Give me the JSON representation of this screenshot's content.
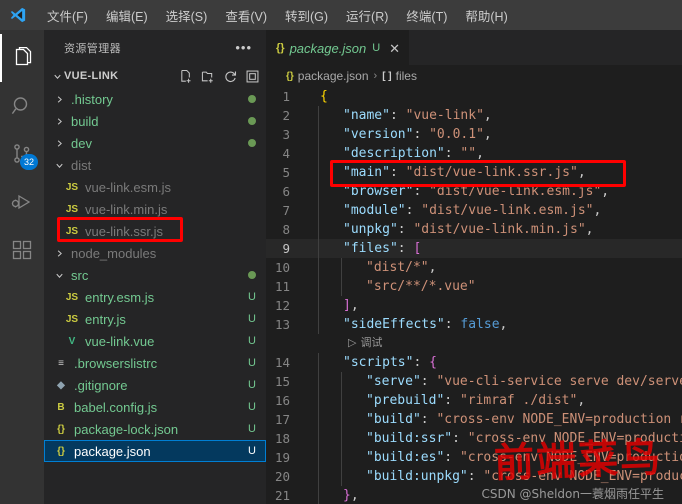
{
  "window": {
    "logo_icon": "vscode-logo-icon"
  },
  "menubar": {
    "items": [
      {
        "label": "文件(F)",
        "name": "menu-file"
      },
      {
        "label": "编辑(E)",
        "name": "menu-edit"
      },
      {
        "label": "选择(S)",
        "name": "menu-selection"
      },
      {
        "label": "查看(V)",
        "name": "menu-view"
      },
      {
        "label": "转到(G)",
        "name": "menu-go"
      },
      {
        "label": "运行(R)",
        "name": "menu-run"
      },
      {
        "label": "终端(T)",
        "name": "menu-terminal"
      },
      {
        "label": "帮助(H)",
        "name": "menu-help"
      }
    ]
  },
  "activitybar": {
    "items": [
      {
        "icon": "explorer-icon",
        "name": "activity-explorer",
        "active": true,
        "badge": ""
      },
      {
        "icon": "search-icon",
        "name": "activity-search",
        "active": false,
        "badge": ""
      },
      {
        "icon": "source-control-icon",
        "name": "activity-source-control",
        "active": false,
        "badge": "32"
      },
      {
        "icon": "run-debug-icon",
        "name": "activity-run-debug",
        "active": false,
        "badge": ""
      },
      {
        "icon": "extensions-icon",
        "name": "activity-extensions",
        "active": false,
        "badge": ""
      }
    ]
  },
  "sidebar": {
    "title": "资源管理器",
    "more_label": "•••",
    "root": {
      "label": "VUE-LINK",
      "expanded": true,
      "actions": [
        {
          "icon": "new-file-icon",
          "name": "new-file-button"
        },
        {
          "icon": "new-folder-icon",
          "name": "new-folder-button"
        },
        {
          "icon": "refresh-icon",
          "name": "refresh-explorer-button"
        },
        {
          "icon": "collapse-all-icon",
          "name": "collapse-all-button"
        }
      ]
    },
    "tree": [
      {
        "label": ".history",
        "kind": "folder",
        "expanded": false,
        "depth": 1,
        "icon": "chevron-right-icon",
        "color": "#73c991",
        "dot": "#6a9955",
        "status": ""
      },
      {
        "label": "build",
        "kind": "folder",
        "expanded": false,
        "depth": 1,
        "icon": "chevron-right-icon",
        "color": "#73c991",
        "dot": "#6a9955",
        "status": ""
      },
      {
        "label": "dev",
        "kind": "folder",
        "expanded": false,
        "depth": 1,
        "icon": "chevron-right-icon",
        "color": "#73c991",
        "dot": "#6a9955",
        "status": ""
      },
      {
        "label": "dist",
        "kind": "folder",
        "expanded": true,
        "depth": 1,
        "icon": "chevron-down-icon",
        "color": "#7a7a7a",
        "dot": "",
        "status": ""
      },
      {
        "label": "vue-link.esm.js",
        "kind": "file",
        "depth": 2,
        "icon": "js-file-icon",
        "iconText": "JS",
        "iconColor": "#cbcb41",
        "color": "#7a7a7a",
        "status": ""
      },
      {
        "label": "vue-link.min.js",
        "kind": "file",
        "depth": 2,
        "icon": "js-file-icon",
        "iconText": "JS",
        "iconColor": "#cbcb41",
        "color": "#7a7a7a",
        "status": ""
      },
      {
        "label": "vue-link.ssr.js",
        "kind": "file",
        "depth": 2,
        "icon": "js-file-icon",
        "iconText": "JS",
        "iconColor": "#cbcb41",
        "color": "#7a7a7a",
        "status": "",
        "highlighted": true
      },
      {
        "label": "node_modules",
        "kind": "folder",
        "expanded": false,
        "depth": 1,
        "icon": "chevron-right-icon",
        "color": "#7a7a7a",
        "dot": "",
        "status": ""
      },
      {
        "label": "src",
        "kind": "folder",
        "expanded": true,
        "depth": 1,
        "icon": "chevron-down-icon",
        "color": "#73c991",
        "dot": "#6a9955",
        "status": ""
      },
      {
        "label": "entry.esm.js",
        "kind": "file",
        "depth": 2,
        "icon": "js-file-icon",
        "iconText": "JS",
        "iconColor": "#cbcb41",
        "color": "#73c991",
        "status": "U"
      },
      {
        "label": "entry.js",
        "kind": "file",
        "depth": 2,
        "icon": "js-file-icon",
        "iconText": "JS",
        "iconColor": "#cbcb41",
        "color": "#73c991",
        "status": "U"
      },
      {
        "label": "vue-link.vue",
        "kind": "file",
        "depth": 2,
        "icon": "vue-file-icon",
        "iconText": "V",
        "iconColor": "#41b883",
        "color": "#73c991",
        "status": "U"
      },
      {
        "label": ".browserslistrc",
        "kind": "file",
        "depth": 1,
        "icon": "config-file-icon",
        "iconText": "≡",
        "iconColor": "#cccccc",
        "color": "#73c991",
        "status": "U"
      },
      {
        "label": ".gitignore",
        "kind": "file",
        "depth": 1,
        "icon": "git-file-icon",
        "iconText": "◆",
        "iconColor": "#8fa3b0",
        "color": "#73c991",
        "status": "U"
      },
      {
        "label": "babel.config.js",
        "kind": "file",
        "depth": 1,
        "icon": "babel-file-icon",
        "iconText": "B",
        "iconColor": "#cbcb41",
        "color": "#73c991",
        "status": "U"
      },
      {
        "label": "package-lock.json",
        "kind": "file",
        "depth": 1,
        "icon": "json-file-icon",
        "iconText": "{}",
        "iconColor": "#cbcb41",
        "color": "#73c991",
        "status": "U"
      },
      {
        "label": "package.json",
        "kind": "file",
        "depth": 1,
        "icon": "json-file-icon",
        "iconText": "{}",
        "iconColor": "#cbcb41",
        "color": "#ffffff",
        "status": "U",
        "selected": true
      }
    ]
  },
  "editor": {
    "tab": {
      "icon": "json-file-icon",
      "icon_text": "{}",
      "label": "package.json",
      "status": "U",
      "close_label": "✕"
    },
    "breadcrumb": {
      "icon_text": "{}",
      "file": "package.json",
      "separator": "›",
      "array_icon": "[ ]",
      "node": "files"
    },
    "codelens": {
      "icon": "play-icon",
      "label": "调试",
      "after_line": 13
    },
    "active_line": 9,
    "lines": [
      {
        "n": 1,
        "indent": 0,
        "tokens": [
          {
            "t": "{",
            "c": "br"
          }
        ]
      },
      {
        "n": 2,
        "indent": 1,
        "tokens": [
          {
            "t": "\"name\"",
            "c": "k"
          },
          {
            "t": ": ",
            "c": "p"
          },
          {
            "t": "\"vue-link\"",
            "c": "s"
          },
          {
            "t": ",",
            "c": "p"
          }
        ]
      },
      {
        "n": 3,
        "indent": 1,
        "tokens": [
          {
            "t": "\"version\"",
            "c": "k"
          },
          {
            "t": ": ",
            "c": "p"
          },
          {
            "t": "\"0.0.1\"",
            "c": "s"
          },
          {
            "t": ",",
            "c": "p"
          }
        ]
      },
      {
        "n": 4,
        "indent": 1,
        "tokens": [
          {
            "t": "\"description\"",
            "c": "k"
          },
          {
            "t": ": ",
            "c": "p"
          },
          {
            "t": "\"\"",
            "c": "s"
          },
          {
            "t": ",",
            "c": "p"
          }
        ]
      },
      {
        "n": 5,
        "indent": 1,
        "tokens": [
          {
            "t": "\"main\"",
            "c": "k"
          },
          {
            "t": ": ",
            "c": "p"
          },
          {
            "t": "\"dist/vue-link.ssr.js\"",
            "c": "s"
          },
          {
            "t": ",",
            "c": "p"
          }
        ]
      },
      {
        "n": 6,
        "indent": 1,
        "tokens": [
          {
            "t": "\"browser\"",
            "c": "k"
          },
          {
            "t": ": ",
            "c": "p"
          },
          {
            "t": "\"dist/vue-link.esm.js\"",
            "c": "s"
          },
          {
            "t": ",",
            "c": "p"
          }
        ]
      },
      {
        "n": 7,
        "indent": 1,
        "tokens": [
          {
            "t": "\"module\"",
            "c": "k"
          },
          {
            "t": ": ",
            "c": "p"
          },
          {
            "t": "\"dist/vue-link.esm.js\"",
            "c": "s"
          },
          {
            "t": ",",
            "c": "p"
          }
        ]
      },
      {
        "n": 8,
        "indent": 1,
        "tokens": [
          {
            "t": "\"unpkg\"",
            "c": "k"
          },
          {
            "t": ": ",
            "c": "p"
          },
          {
            "t": "\"dist/vue-link.min.js\"",
            "c": "s"
          },
          {
            "t": ",",
            "c": "p"
          }
        ]
      },
      {
        "n": 9,
        "indent": 1,
        "tokens": [
          {
            "t": "\"files\"",
            "c": "k"
          },
          {
            "t": ": ",
            "c": "p"
          },
          {
            "t": "[",
            "c": "br2"
          }
        ]
      },
      {
        "n": 10,
        "indent": 2,
        "tokens": [
          {
            "t": "\"dist/*\"",
            "c": "s"
          },
          {
            "t": ",",
            "c": "p"
          }
        ]
      },
      {
        "n": 11,
        "indent": 2,
        "tokens": [
          {
            "t": "\"src/**/*.vue\"",
            "c": "s"
          }
        ]
      },
      {
        "n": 12,
        "indent": 1,
        "tokens": [
          {
            "t": "]",
            "c": "br2"
          },
          {
            "t": ",",
            "c": "p"
          }
        ]
      },
      {
        "n": 13,
        "indent": 1,
        "tokens": [
          {
            "t": "\"sideEffects\"",
            "c": "k"
          },
          {
            "t": ": ",
            "c": "p"
          },
          {
            "t": "false",
            "c": "b"
          },
          {
            "t": ",",
            "c": "p"
          }
        ]
      },
      {
        "n": 14,
        "indent": 1,
        "tokens": [
          {
            "t": "\"scripts\"",
            "c": "k"
          },
          {
            "t": ": ",
            "c": "p"
          },
          {
            "t": "{",
            "c": "br2"
          }
        ]
      },
      {
        "n": 15,
        "indent": 2,
        "tokens": [
          {
            "t": "\"serve\"",
            "c": "k"
          },
          {
            "t": ": ",
            "c": "p"
          },
          {
            "t": "\"vue-cli-service serve dev/serve.",
            "c": "s"
          }
        ]
      },
      {
        "n": 16,
        "indent": 2,
        "tokens": [
          {
            "t": "\"prebuild\"",
            "c": "k"
          },
          {
            "t": ": ",
            "c": "p"
          },
          {
            "t": "\"rimraf ./dist\"",
            "c": "s"
          },
          {
            "t": ",",
            "c": "p"
          }
        ]
      },
      {
        "n": 17,
        "indent": 2,
        "tokens": [
          {
            "t": "\"build\"",
            "c": "k"
          },
          {
            "t": ": ",
            "c": "p"
          },
          {
            "t": "\"cross-env NODE_ENV=production ro",
            "c": "s"
          }
        ]
      },
      {
        "n": 18,
        "indent": 2,
        "tokens": [
          {
            "t": "\"build:ssr\"",
            "c": "k"
          },
          {
            "t": ": ",
            "c": "p"
          },
          {
            "t": "\"cross-env NODE_ENV=productio",
            "c": "s"
          }
        ]
      },
      {
        "n": 19,
        "indent": 2,
        "tokens": [
          {
            "t": "\"build:es\"",
            "c": "k"
          },
          {
            "t": ": ",
            "c": "p"
          },
          {
            "t": "\"cross-env NODE_ENV=production",
            "c": "s"
          }
        ]
      },
      {
        "n": 20,
        "indent": 2,
        "tokens": [
          {
            "t": "\"build:unpkg\"",
            "c": "k"
          },
          {
            "t": ": ",
            "c": "p"
          },
          {
            "t": "\"cross-env NODE_ENV=produc",
            "c": "s"
          }
        ]
      },
      {
        "n": 21,
        "indent": 1,
        "tokens": [
          {
            "t": "}",
            "c": "br2"
          },
          {
            "t": ",",
            "c": "p"
          }
        ]
      }
    ]
  },
  "annotations": {
    "file_box_label": "highlight-vue-link-ssr-js",
    "main_box_label": "highlight-main-field",
    "color": "#ff0000"
  },
  "watermark": {
    "red_text": "前端菜鸟",
    "csdn_text": "CSDN @Sheldon一蓑烟雨任平生"
  }
}
